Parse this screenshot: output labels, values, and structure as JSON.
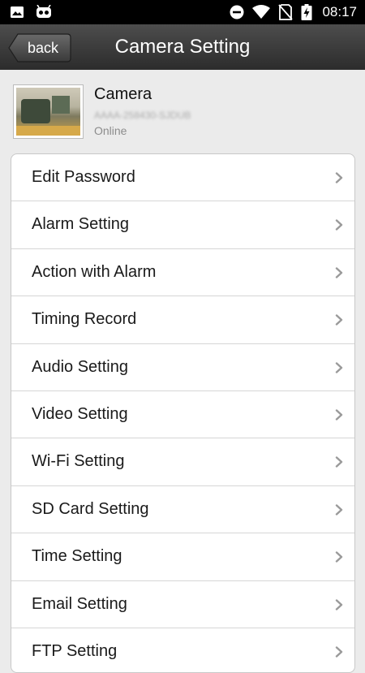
{
  "status_bar": {
    "time": "08:17",
    "left_icons": [
      "image-icon",
      "android-debug-icon"
    ],
    "right_icons": [
      "do-not-disturb-icon",
      "wifi-icon",
      "no-sim-icon",
      "battery-charging-icon"
    ]
  },
  "header": {
    "back_label": "back",
    "title": "Camera Setting"
  },
  "camera": {
    "name": "Camera",
    "id": "AAAA-258430-SJDUB",
    "status": "Online"
  },
  "menu": {
    "items": [
      {
        "label": "Edit Password"
      },
      {
        "label": "Alarm Setting"
      },
      {
        "label": "Action with Alarm"
      },
      {
        "label": "Timing Record"
      },
      {
        "label": "Audio Setting"
      },
      {
        "label": "Video Setting"
      },
      {
        "label": "Wi-Fi Setting"
      },
      {
        "label": "SD Card Setting"
      },
      {
        "label": "Time Setting"
      },
      {
        "label": "Email Setting"
      },
      {
        "label": "FTP Setting"
      }
    ]
  },
  "colors": {
    "header_top": "#4d4d4d",
    "header_bottom": "#2c2c2c",
    "background": "#ebebeb",
    "chevron": "#9a9a9a"
  }
}
